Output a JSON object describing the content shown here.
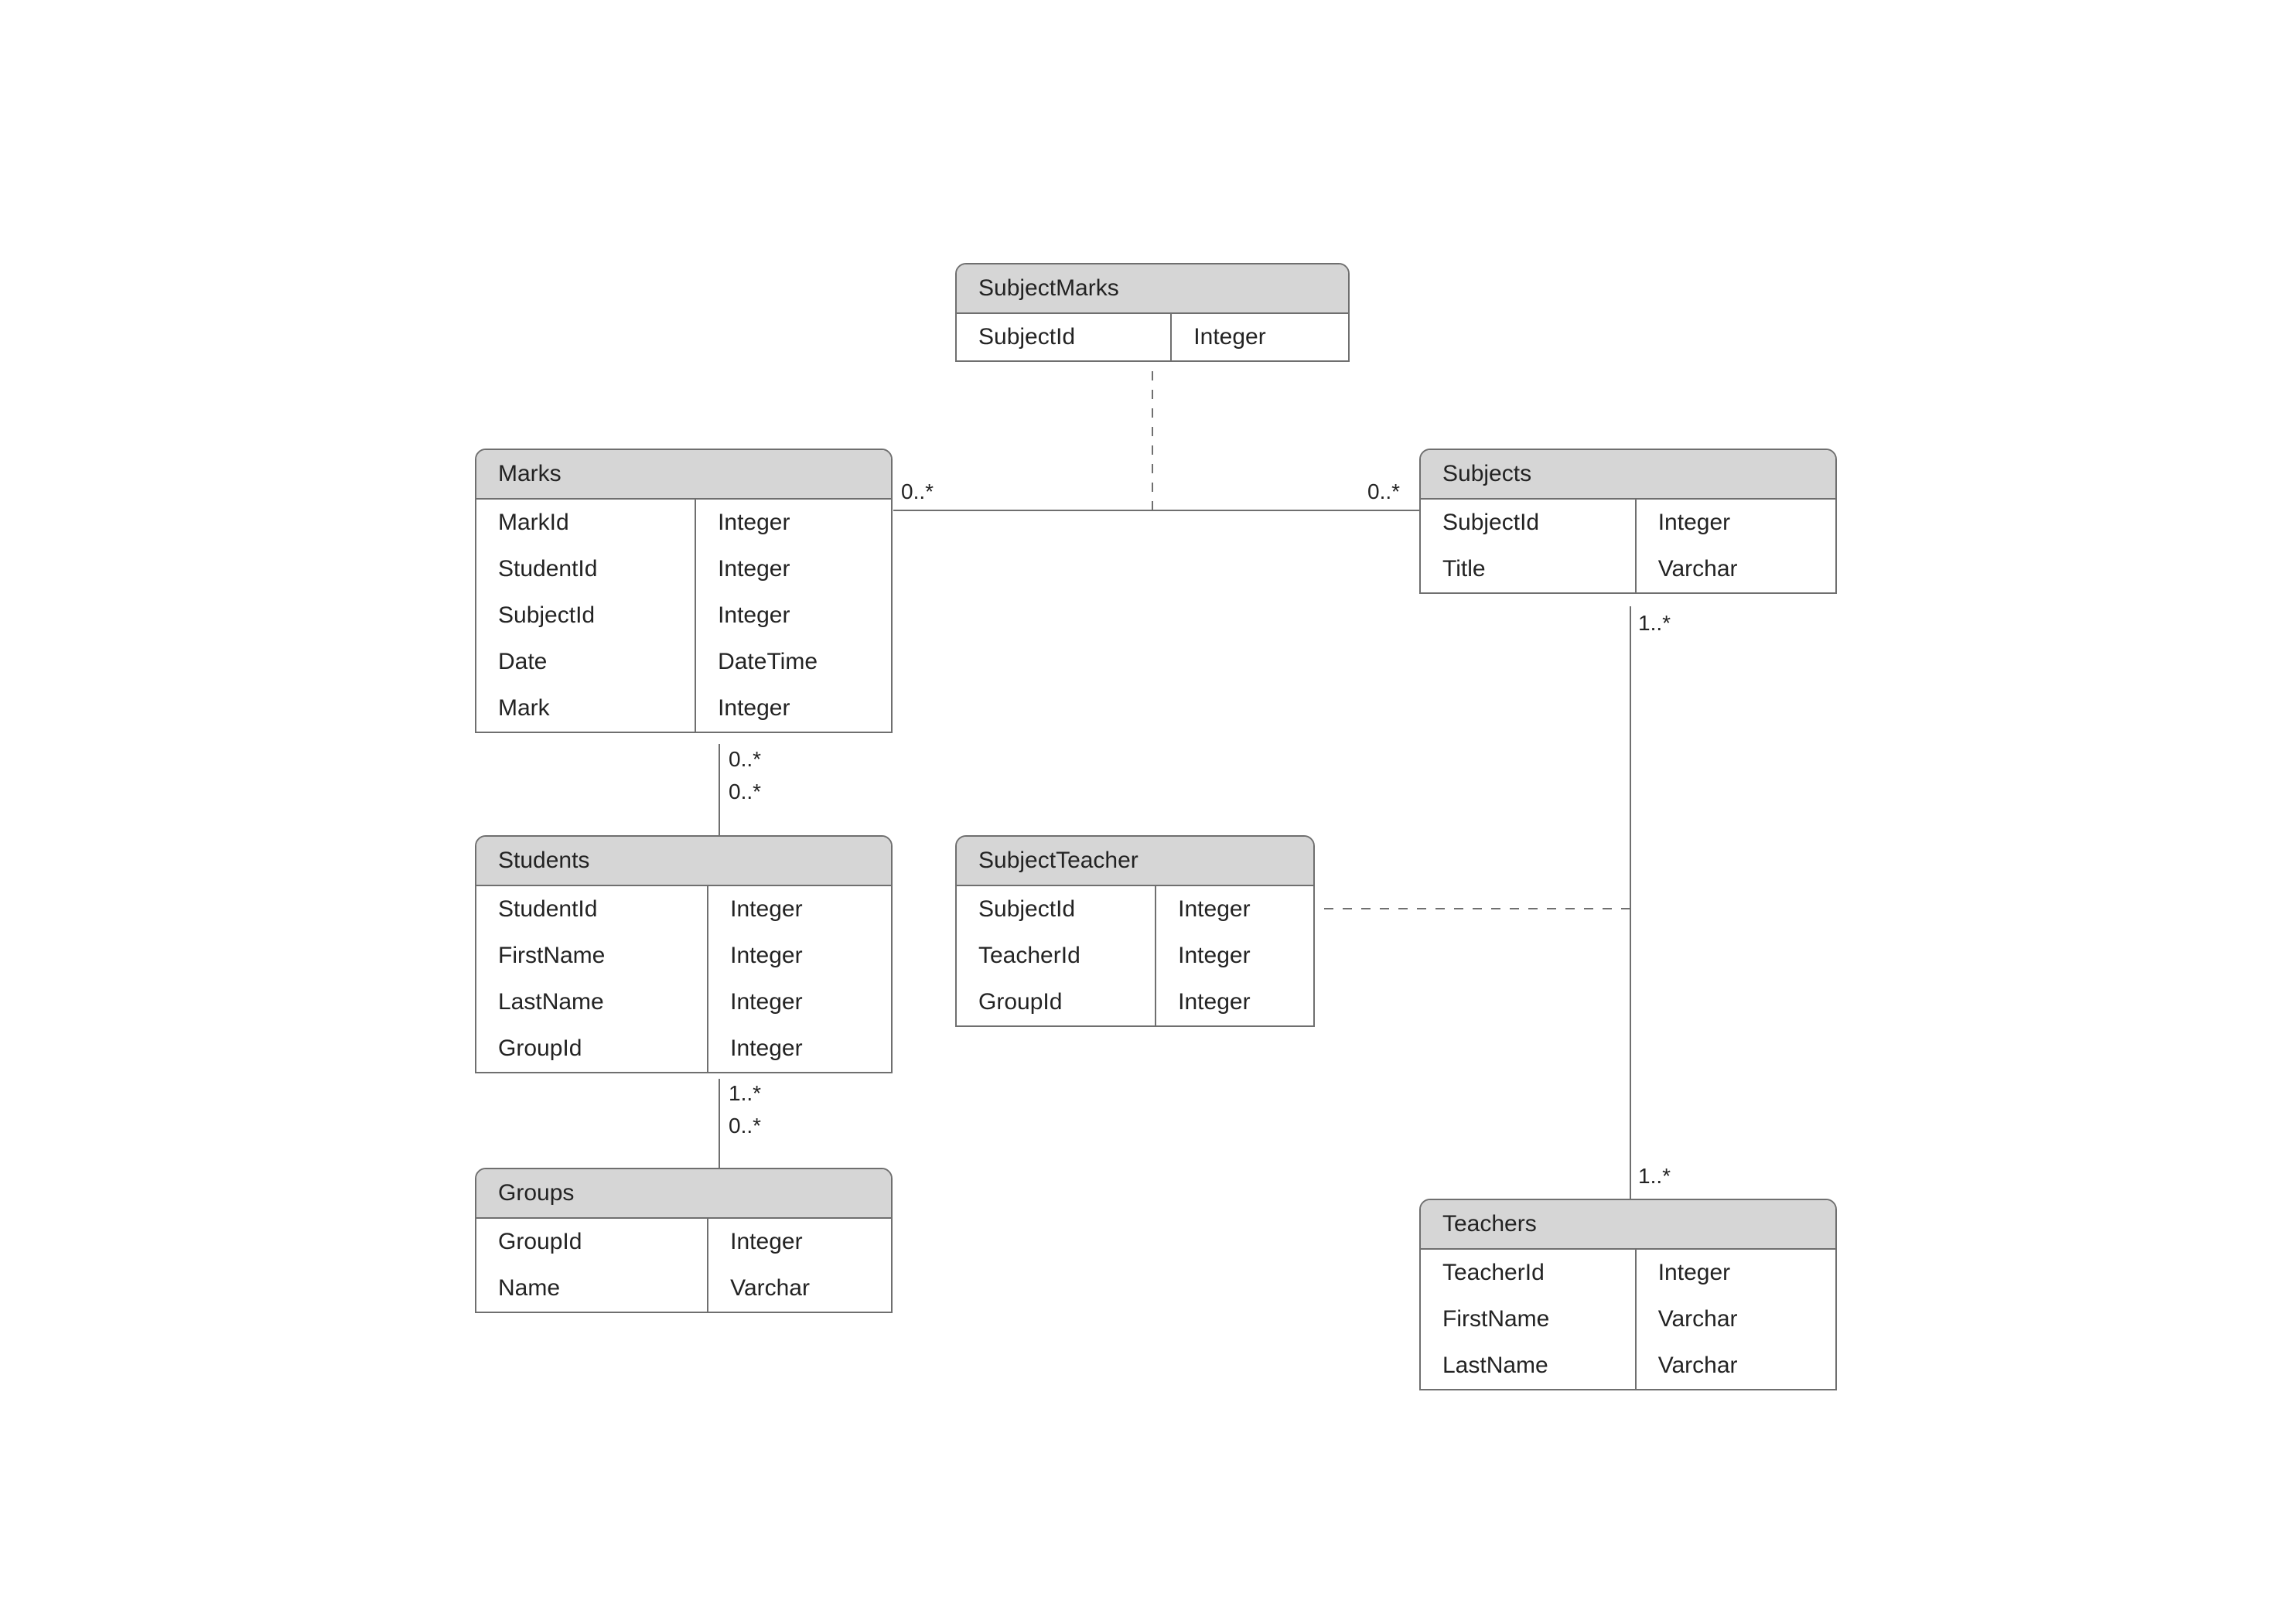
{
  "entities": {
    "subjectMarks": {
      "title": "SubjectMarks",
      "fields": [
        {
          "name": "SubjectId",
          "type": "Integer"
        }
      ]
    },
    "marks": {
      "title": "Marks",
      "fields": [
        {
          "name": "MarkId",
          "type": "Integer"
        },
        {
          "name": "StudentId",
          "type": "Integer"
        },
        {
          "name": "SubjectId",
          "type": "Integer"
        },
        {
          "name": "Date",
          "type": "DateTime"
        },
        {
          "name": "Mark",
          "type": "Integer"
        }
      ]
    },
    "subjects": {
      "title": "Subjects",
      "fields": [
        {
          "name": "SubjectId",
          "type": "Integer"
        },
        {
          "name": "Title",
          "type": "Varchar"
        }
      ]
    },
    "students": {
      "title": "Students",
      "fields": [
        {
          "name": "StudentId",
          "type": "Integer"
        },
        {
          "name": "FirstName",
          "type": "Integer"
        },
        {
          "name": "LastName",
          "type": "Integer"
        },
        {
          "name": "GroupId",
          "type": "Integer"
        }
      ]
    },
    "subjectTeacher": {
      "title": "SubjectTeacher",
      "fields": [
        {
          "name": "SubjectId",
          "type": "Integer"
        },
        {
          "name": "TeacherId",
          "type": "Integer"
        },
        {
          "name": "GroupId",
          "type": "Integer"
        }
      ]
    },
    "groups": {
      "title": "Groups",
      "fields": [
        {
          "name": "GroupId",
          "type": "Integer"
        },
        {
          "name": "Name",
          "type": "Varchar"
        }
      ]
    },
    "teachers": {
      "title": "Teachers",
      "fields": [
        {
          "name": "TeacherId",
          "type": "Integer"
        },
        {
          "name": "FirstName",
          "type": "Varchar"
        },
        {
          "name": "LastName",
          "type": "Varchar"
        }
      ]
    }
  },
  "cardinalities": {
    "marks_to_subjects_left": "0..*",
    "marks_to_subjects_right": "0..*",
    "subjects_to_teachers": "1..*",
    "teachers_to_subjects": "1..*",
    "marks_to_students_top": "0..*",
    "students_from_marks": "0..*",
    "students_to_groups": "1..*",
    "groups_from_students": "0..*"
  }
}
